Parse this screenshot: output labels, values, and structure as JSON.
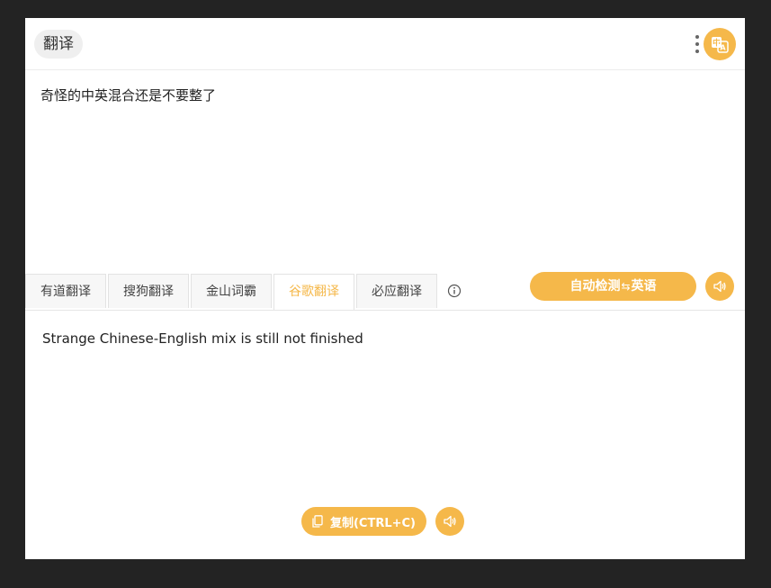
{
  "header": {
    "title": "翻译",
    "more_icon": "more-vertical-icon",
    "logo_icon": "translate-icon"
  },
  "input": {
    "text": "奇怪的中英混合还是不要整了"
  },
  "tabs": [
    {
      "label": "有道翻译",
      "active": false
    },
    {
      "label": "搜狗翻译",
      "active": false
    },
    {
      "label": "金山词霸",
      "active": false
    },
    {
      "label": "谷歌翻译",
      "active": true
    },
    {
      "label": "必应翻译",
      "active": false
    }
  ],
  "info_icon": "info-icon",
  "language": {
    "source": "自动检测",
    "swap": "⇆",
    "target": "英语"
  },
  "output": {
    "text": "Strange Chinese-English mix is still not finished"
  },
  "copy": {
    "label": "复制(CTRL+C)",
    "icon": "copy-icon"
  },
  "speaker_icon": "speaker-icon",
  "colors": {
    "accent": "#f5b84a",
    "background": "#232323",
    "panel": "#ffffff"
  }
}
